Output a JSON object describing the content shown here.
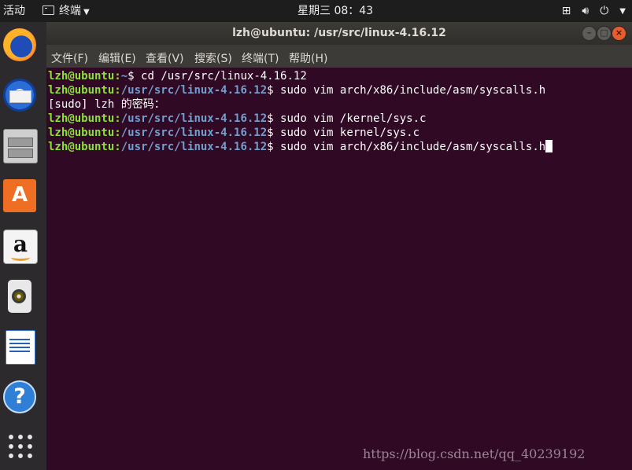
{
  "topbar": {
    "activities": "活动",
    "app_name": "终端",
    "clock": "星期三 08：43",
    "status_icons": [
      "network-icon",
      "volume-icon",
      "power-icon",
      "chevron-down-icon"
    ]
  },
  "dock": {
    "items": [
      "firefox-icon",
      "thunderbird-icon",
      "files-icon",
      "software-store-icon",
      "amazon-icon",
      "rhythmbox-icon",
      "libreoffice-writer-icon",
      "help-icon",
      "show-apps-icon"
    ],
    "store_glyph": "A",
    "amazon_glyph": "a",
    "help_glyph": "?"
  },
  "window": {
    "title": "lzh@ubuntu: /usr/src/linux-4.16.12",
    "menu": [
      "文件(F)",
      "编辑(E)",
      "查看(V)",
      "搜索(S)",
      "终端(T)",
      "帮助(H)"
    ]
  },
  "terminal": {
    "lines": [
      {
        "user": "lzh@ubuntu",
        "path": "~",
        "command": "$ cd /usr/src/linux-4.16.12"
      },
      {
        "user": "lzh@ubuntu",
        "path": "/usr/src/linux-4.16.12",
        "command": "$ sudo vim arch/x86/include/asm/syscalls.h"
      },
      {
        "text": "[sudo] lzh 的密码："
      },
      {
        "user": "lzh@ubuntu",
        "path": "/usr/src/linux-4.16.12",
        "command": "$ sudo vim /kernel/sys.c"
      },
      {
        "user": "lzh@ubuntu",
        "path": "/usr/src/linux-4.16.12",
        "command": "$ sudo vim kernel/sys.c"
      },
      {
        "user": "lzh@ubuntu",
        "path": "/usr/src/linux-4.16.12",
        "command": "$ sudo vim arch/x86/include/asm/syscalls.h"
      }
    ]
  },
  "watermark": "https://blog.csdn.net/qq_40239192"
}
